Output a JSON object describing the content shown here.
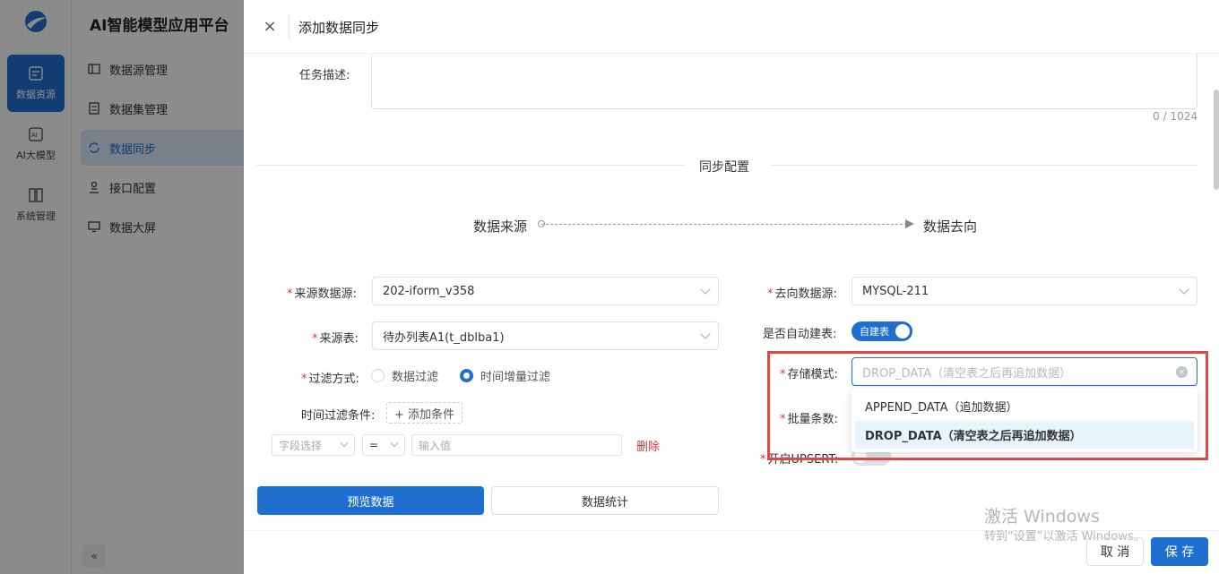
{
  "platform": {
    "title": "AI智能模型应用平台"
  },
  "rail": [
    {
      "label": "数据资源",
      "icon": "data-resource-icon"
    },
    {
      "label": "AI大模型",
      "icon": "ai-model-icon"
    },
    {
      "label": "系统管理",
      "icon": "system-manage-icon"
    }
  ],
  "menu": [
    {
      "label": "数据源管理",
      "icon": "datasource-icon"
    },
    {
      "label": "数据集管理",
      "icon": "dataset-icon"
    },
    {
      "label": "数据同步",
      "icon": "sync-icon"
    },
    {
      "label": "接口配置",
      "icon": "api-icon"
    },
    {
      "label": "数据大屏",
      "icon": "screen-icon"
    }
  ],
  "collapse": "«",
  "drawer": {
    "close": "×",
    "title": "添加数据同步",
    "task_desc_label": "任务描述:",
    "counter": "0 / 1024",
    "section_title": "同步配置",
    "flow_source": "数据来源",
    "flow_target": "数据去向"
  },
  "source": {
    "datasource_label": "来源数据源:",
    "datasource_value": "202-iform_v358",
    "table_label": "来源表:",
    "table_value": "待办列表A1(t_dblba1)",
    "filter_label": "过滤方式:",
    "filter_options": [
      "数据过滤",
      "时间增量过滤"
    ],
    "time_cond_label": "时间过滤条件:",
    "add_cond": "+ 添加条件",
    "field_placeholder": "字段选择",
    "operator": "=",
    "value_placeholder": "输入值",
    "delete": "删除",
    "preview_btn": "预览数据",
    "stats_btn": "数据统计"
  },
  "target": {
    "datasource_label": "去向数据源:",
    "datasource_value": "MYSQL-211",
    "auto_create_label": "是否自动建表:",
    "auto_create_switch": "自建表",
    "storage_label": "存储模式:",
    "storage_placeholder": "DROP_DATA（清空表之后再追加数据）",
    "storage_options": [
      "APPEND_DATA（追加数据）",
      "DROP_DATA（清空表之后再追加数据）"
    ],
    "batch_label": "批量条数:",
    "upsert_label": "开启UPSERT:"
  },
  "footer": {
    "cancel": "取 消",
    "save": "保 存"
  },
  "watermark": {
    "line1": "激活 Windows",
    "line2": "转到“设置”以激活 Windows。"
  }
}
